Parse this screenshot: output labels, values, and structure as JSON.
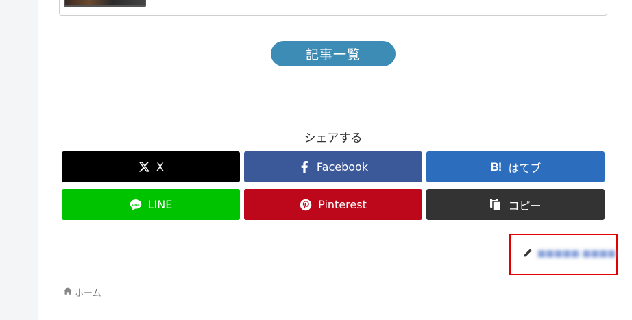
{
  "related": {
    "thumbnail_icon": "related-article-thumbnail"
  },
  "article_list_button": "記事一覧",
  "share": {
    "title": "シェアする",
    "buttons": [
      {
        "label": "X",
        "icon": "x-logo-icon",
        "color": "#000000"
      },
      {
        "label": "Facebook",
        "icon": "facebook-icon",
        "color": "#3b5998"
      },
      {
        "label": "はてブ",
        "icon": "hatena-bookmark-icon",
        "color": "#2c6ebd"
      },
      {
        "label": "LINE",
        "icon": "line-icon",
        "color": "#00c300"
      },
      {
        "label": "Pinterest",
        "icon": "pinterest-icon",
        "color": "#bd081c"
      },
      {
        "label": "コピー",
        "icon": "copy-icon",
        "color": "#333333"
      }
    ]
  },
  "edit": {
    "icon": "pencil-icon",
    "link_text": "edit-with-blurred-text",
    "highlight_color": "#e00000"
  },
  "breadcrumb": {
    "icon": "home-icon",
    "home_label": "ホーム"
  }
}
